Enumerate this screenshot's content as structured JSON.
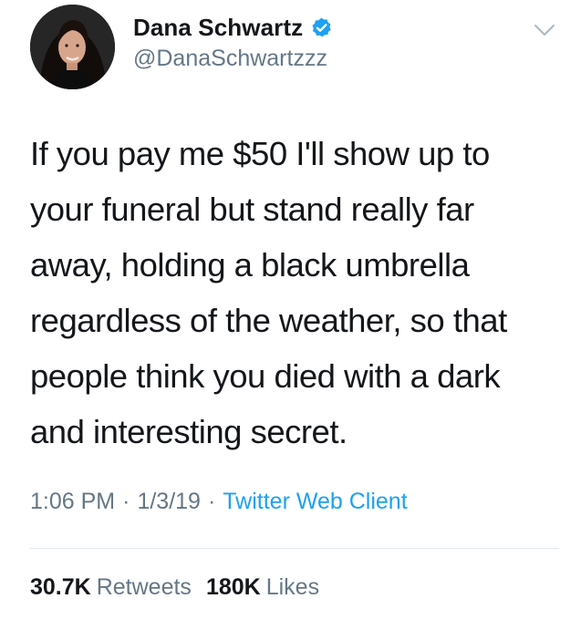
{
  "author": {
    "display_name": "Dana Schwartz",
    "handle": "@DanaSchwartzzz",
    "verified": true,
    "avatar": "profile-photo"
  },
  "tweet": {
    "text": "If you pay me $50 I'll show up to\nyour funeral but stand really far\naway, holding a black umbrella\nregardless of the weather, so that\npeople think you died with a dark\nand interesting secret."
  },
  "meta": {
    "time": "1:06 PM",
    "date": "1/3/19",
    "separator": "·",
    "client": "Twitter Web Client"
  },
  "stats": {
    "retweets_count": "30.7K",
    "retweets_label": "Retweets",
    "likes_count": "180K",
    "likes_label": "Likes"
  },
  "icons": {
    "verified": "verified-badge-icon",
    "menu": "chevron-down-icon"
  },
  "colors": {
    "text": "#14171a",
    "secondary": "#657786",
    "link": "#1da1f2",
    "divider": "#e1e8ed"
  }
}
